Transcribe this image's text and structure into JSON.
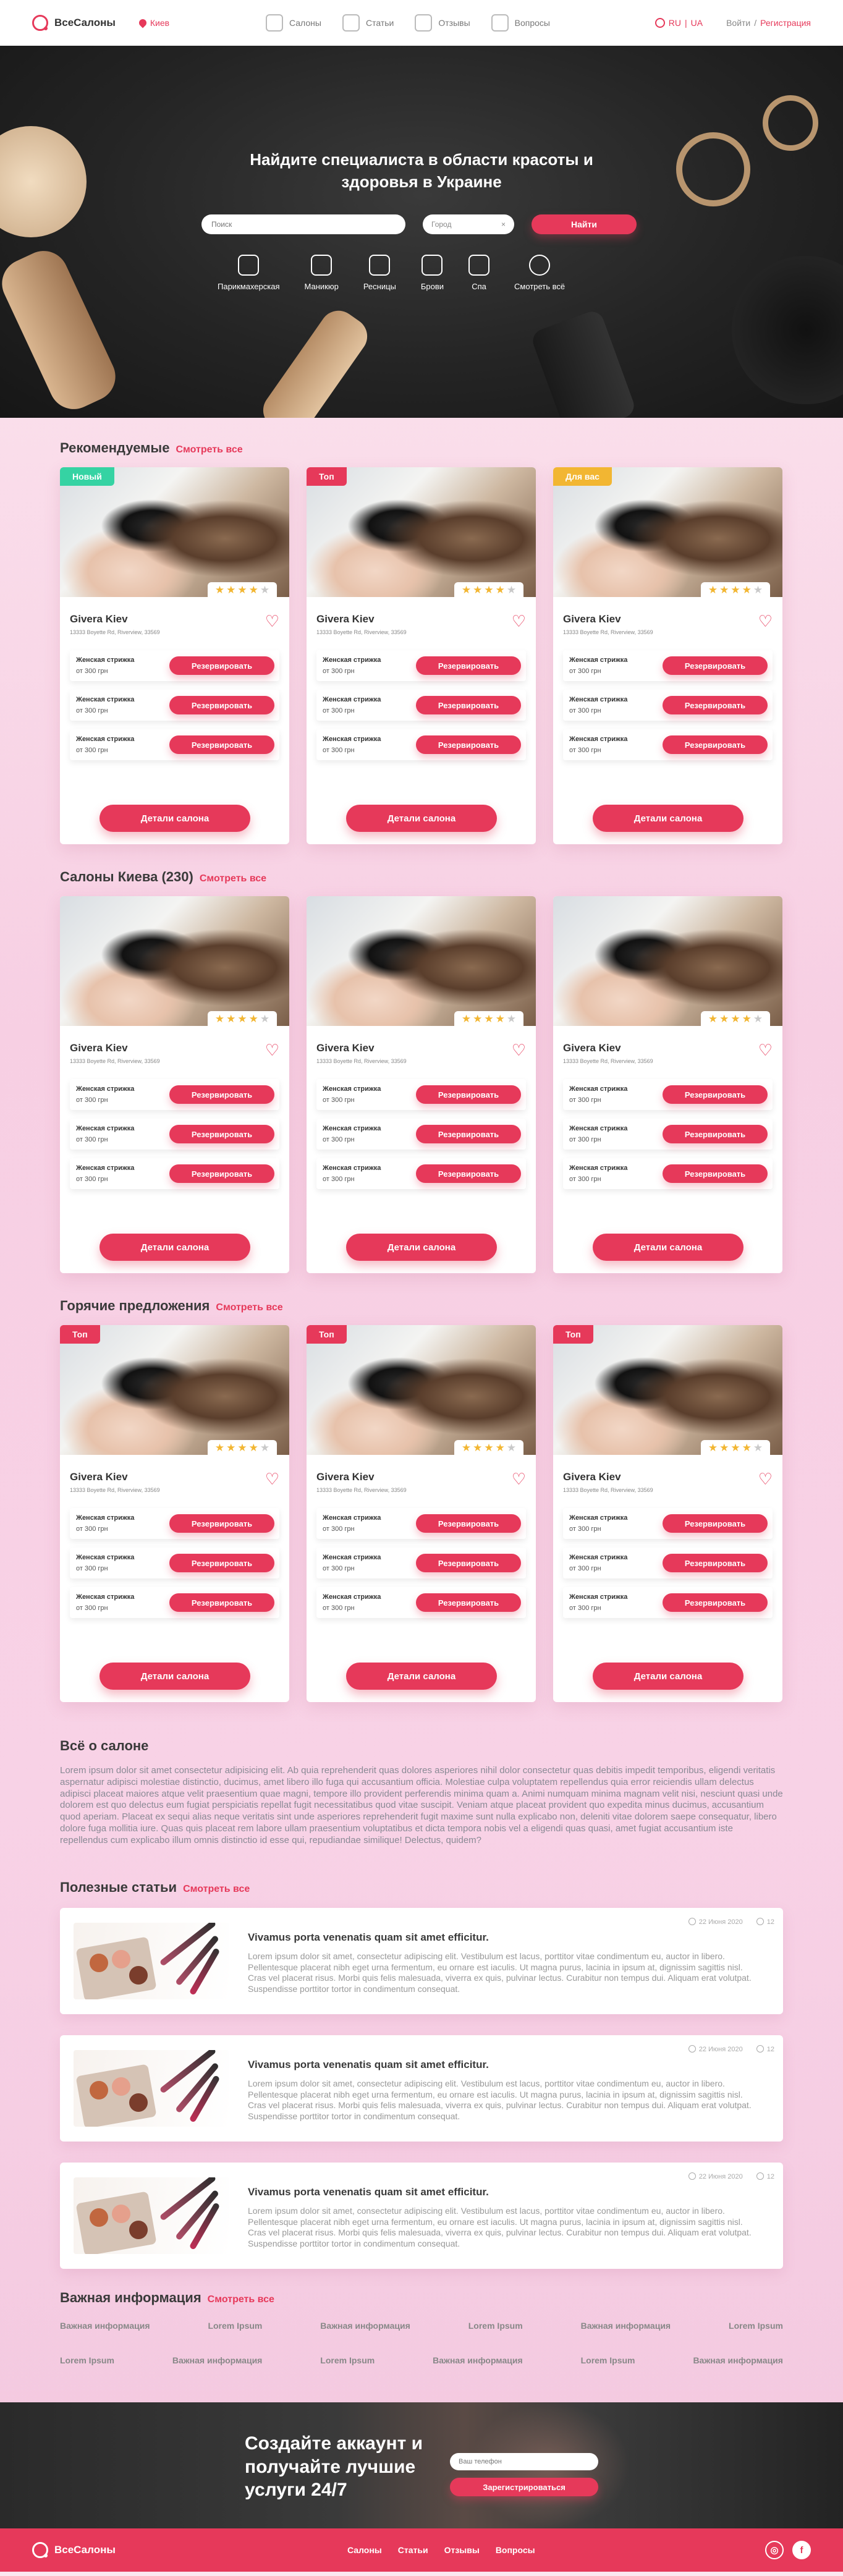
{
  "header": {
    "logo": "ВсеСалоны",
    "city": "Киев",
    "nav": [
      {
        "label": "Салоны",
        "icon": "scissors-icon"
      },
      {
        "label": "Статьи",
        "icon": "article-icon"
      },
      {
        "label": "Отзывы",
        "icon": "review-icon"
      },
      {
        "label": "Вопросы",
        "icon": "question-icon"
      }
    ],
    "lang_ru": "RU",
    "lang_sep": "|",
    "lang_ua": "UA",
    "login": "Войти",
    "auth_sep": "/",
    "register": "Регистрация"
  },
  "hero": {
    "title_line1": "Найдите специалиста в области красоты и",
    "title_line2": "здоровья в Украине",
    "search_placeholder": "Поиск",
    "city_placeholder": "Город",
    "city_clear": "×",
    "find_button": "Найти",
    "categories": [
      {
        "label": "Парикмахерская",
        "icon": "hairdresser-icon"
      },
      {
        "label": "Маникюр",
        "icon": "manicure-icon"
      },
      {
        "label": "Ресницы",
        "icon": "eyelash-icon"
      },
      {
        "label": "Брови",
        "icon": "eyebrow-icon"
      },
      {
        "label": "Спа",
        "icon": "spa-icon"
      },
      {
        "label": "Смотреть всё",
        "icon": "arrow-right-icon"
      }
    ]
  },
  "card_common": {
    "name": "Givera Kiev",
    "address": "13333 Boyette Rd, Riverview, 33569",
    "service_name": "Женская стрижка",
    "service_price": "от 300 грн",
    "book_label": "Резервировать",
    "details_label": "Детали салона",
    "rating": 4
  },
  "sections": {
    "recommended": {
      "title": "Рекомендуемые",
      "link": "Смотреть все",
      "badges": [
        "Новый",
        "Топ",
        "Для вас"
      ],
      "badge_colors": [
        "#35d3a3",
        "#e6395a",
        "#f2b632"
      ]
    },
    "kiev": {
      "title": "Салоны Киева  (230)",
      "link": "Смотреть все"
    },
    "hot": {
      "title": "Горячие предложения",
      "link": "Смотреть все",
      "badges": [
        "Топ",
        "Топ",
        "Топ"
      ],
      "badge_colors": [
        "#e6395a",
        "#e6395a",
        "#e6395a"
      ]
    }
  },
  "about": {
    "title": "Всё о салоне",
    "text": "Lorem ipsum dolor sit amet consectetur adipisicing elit. Ab quia reprehenderit quas dolores asperiores nihil dolor consectetur quas debitis impedit temporibus, eligendi veritatis aspernatur adipisci molestiae distinctio, ducimus, amet libero illo fuga qui accusantium officia. Molestiae culpa voluptatem repellendus quia error reiciendis ullam delectus adipisci placeat maiores atque velit praesentium quae magni, tempore illo provident perferendis minima quam a. Animi numquam minima magnam velit nisi, nesciunt quasi unde dolorem est quo delectus eum fugiat perspiciatis repellat fugit necessitatibus quod vitae suscipit. Veniam atque placeat provident quo expedita minus ducimus, accusantium quod aperiam. Placeat ex sequi alias neque veritatis sint unde asperiores reprehenderit fugit maxime sunt nulla explicabo non, deleniti vitae dolorem saepe consequatur, libero dolore fuga mollitia iure. Quas quis placeat rem labore ullam praesentium voluptatibus et dicta tempora nobis vel a eligendi quas quasi, amet fugiat accusantium iste repellendus cum explicabo illum omnis distinctio id esse qui, repudiandae similique! Delectus, quidem?"
  },
  "articles": {
    "title": "Полезные статьи",
    "link": "Смотреть все",
    "items": [
      {
        "title": "Vivamus porta venenatis quam sit amet efficitur.",
        "date": "22 Июня 2020",
        "views": "12",
        "text": "Lorem ipsum dolor sit amet, consectetur adipiscing elit. Vestibulum est lacus, porttitor vitae condimentum eu, auctor in libero. Pellentesque placerat nibh eget urna fermentum, eu ornare est iaculis. Ut magna purus, lacinia in ipsum at, dignissim sagittis nisl. Cras vel placerat risus. Morbi quis felis malesuada, viverra ex quis, pulvinar lectus. Curabitur non tempus dui. Aliquam erat volutpat. Suspendisse porttitor tortor in condimentum consequat."
      },
      {
        "title": "Vivamus porta venenatis quam sit amet efficitur.",
        "date": "22 Июня 2020",
        "views": "12",
        "text": "Lorem ipsum dolor sit amet, consectetur adipiscing elit. Vestibulum est lacus, porttitor vitae condimentum eu, auctor in libero. Pellentesque placerat nibh eget urna fermentum, eu ornare est iaculis. Ut magna purus, lacinia in ipsum at, dignissim sagittis nisl. Cras vel placerat risus. Morbi quis felis malesuada, viverra ex quis, pulvinar lectus. Curabitur non tempus dui. Aliquam erat volutpat. Suspendisse porttitor tortor in condimentum consequat."
      },
      {
        "title": "Vivamus porta venenatis quam sit amet efficitur.",
        "date": "22 Июня 2020",
        "views": "12",
        "text": "Lorem ipsum dolor sit amet, consectetur adipiscing elit. Vestibulum est lacus, porttitor vitae condimentum eu, auctor in libero. Pellentesque placerat nibh eget urna fermentum, eu ornare est iaculis. Ut magna purus, lacinia in ipsum at, dignissim sagittis nisl. Cras vel placerat risus. Morbi quis felis malesuada, viverra ex quis, pulvinar lectus. Curabitur non tempus dui. Aliquam erat volutpat. Suspendisse porttitor tortor in condimentum consequat."
      }
    ]
  },
  "info": {
    "title": "Важная информация",
    "link": "Смотреть все",
    "row1": [
      "Важная информация",
      "Lorem Ipsum",
      "Важная информация",
      "Lorem Ipsum",
      "Важная информация",
      "Lorem Ipsum"
    ],
    "row2": [
      "Lorem Ipsum",
      "Важная информация",
      "Lorem Ipsum",
      "Важная информация",
      "Lorem Ipsum",
      "Важная информация"
    ]
  },
  "signup": {
    "title": "Создайте аккаунт и получайте лучшие услуги 24/7",
    "phone_placeholder": "Ваш телефон",
    "button": "Зарегистрироваться"
  },
  "footer": {
    "logo": "ВсеСалоны",
    "nav": [
      "Салоны",
      "Статьи",
      "Отзывы",
      "Вопросы"
    ],
    "instagram_glyph": "◎",
    "facebook_glyph": "f"
  },
  "colors": {
    "accent": "#e6395a",
    "new_badge": "#35d3a3",
    "for_you_badge": "#f2b632",
    "star": "#f2b632"
  }
}
